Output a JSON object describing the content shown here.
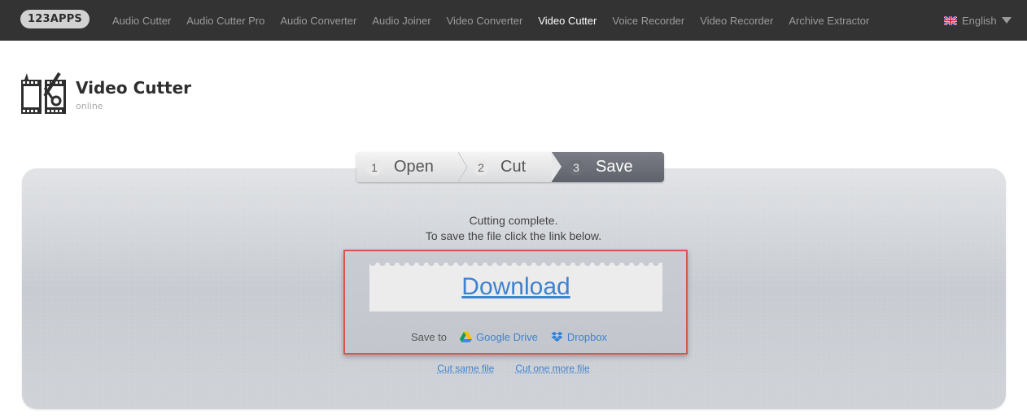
{
  "topbar": {
    "logo": "123APPS",
    "nav": [
      {
        "label": "Audio Cutter",
        "active": false
      },
      {
        "label": "Audio Cutter Pro",
        "active": false
      },
      {
        "label": "Audio Converter",
        "active": false
      },
      {
        "label": "Audio Joiner",
        "active": false
      },
      {
        "label": "Video Converter",
        "active": false
      },
      {
        "label": "Video Cutter",
        "active": true
      },
      {
        "label": "Voice Recorder",
        "active": false
      },
      {
        "label": "Video Recorder",
        "active": false
      },
      {
        "label": "Archive Extractor",
        "active": false
      }
    ],
    "language": "English"
  },
  "header": {
    "title": "Video Cutter",
    "subtitle": "online"
  },
  "steps": [
    {
      "num": "1",
      "label": "Open",
      "active": false
    },
    {
      "num": "2",
      "label": "Cut",
      "active": false
    },
    {
      "num": "3",
      "label": "Save",
      "active": true
    }
  ],
  "result": {
    "line1": "Cutting complete.",
    "line2": "To save the file click the link below.",
    "download": "Download",
    "save_to": "Save to",
    "google_drive": "Google Drive",
    "dropbox": "Dropbox"
  },
  "links": {
    "cut_same": "Cut same file",
    "cut_more": "Cut one more file"
  },
  "colors": {
    "accent": "#3f82d0",
    "highlight_border": "#d9534f",
    "topbar": "#333333"
  }
}
